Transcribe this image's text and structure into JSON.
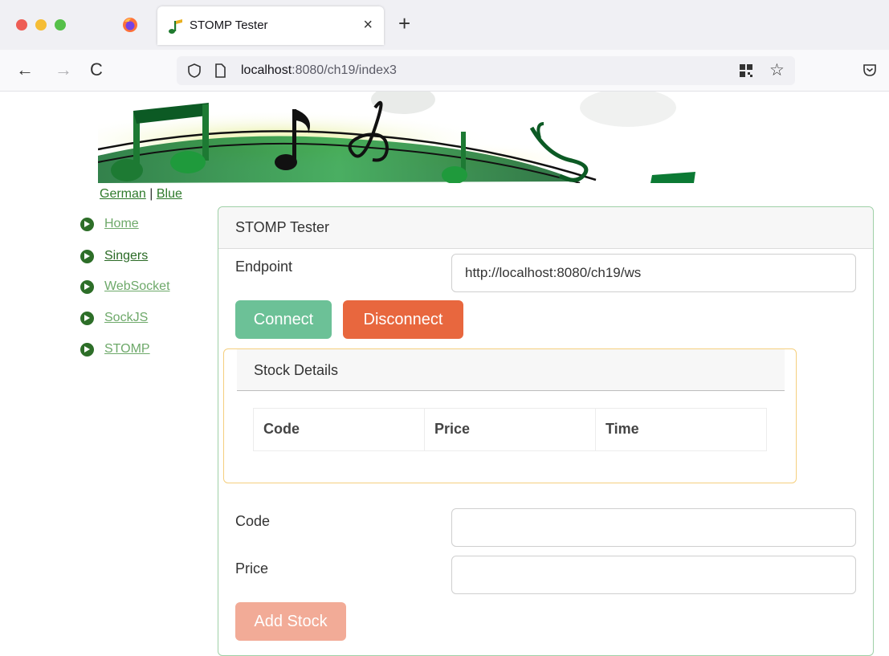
{
  "browser": {
    "tab_title": "STOMP Tester",
    "tab_close": "×",
    "new_tab": "+",
    "nav_back": "←",
    "nav_forward": "→",
    "nav_reload": "C",
    "url_host": "localhost",
    "url_rest": ":8080/ch19/index3",
    "bookmark_star": "☆"
  },
  "page": {
    "lang_german": "German",
    "lang_separator": " | ",
    "lang_blue": "Blue",
    "nav": [
      {
        "label": "Home"
      },
      {
        "label": "Singers"
      },
      {
        "label": "WebSocket"
      },
      {
        "label": "SockJS"
      },
      {
        "label": "STOMP"
      }
    ],
    "panel_title": "STOMP Tester",
    "endpoint_label": "Endpoint",
    "endpoint_value": "http://localhost:8080/ch19/ws",
    "connect_label": "Connect",
    "disconnect_label": "Disconnect",
    "stock_title": "Stock Details",
    "table_headers": [
      "Code",
      "Price",
      "Time"
    ],
    "code_label": "Code",
    "code_value": "",
    "price_label": "Price",
    "price_value": "",
    "add_stock_label": "Add Stock"
  },
  "colors": {
    "connect": "#6cc197",
    "disconnect": "#e8673e",
    "add_stock": "#f2ab97",
    "panel_border": "#9fd0a7",
    "stock_border": "#f5cf7e",
    "link_green": "#2f7a2b"
  }
}
